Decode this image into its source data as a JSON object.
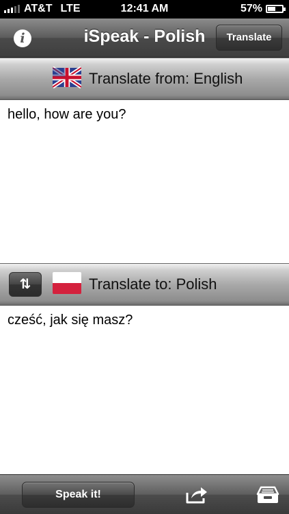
{
  "status_bar": {
    "carrier": "AT&T",
    "network": "LTE",
    "time": "12:41 AM",
    "battery_percent": "57%",
    "battery_level": 0.57
  },
  "nav": {
    "title": "iSpeak - Polish",
    "info_icon": "info-icon",
    "translate_label": "Translate"
  },
  "from": {
    "label": "Translate from: English",
    "flag": "uk-flag-icon",
    "text": "hello, how are you?"
  },
  "to": {
    "label": "Translate to: Polish",
    "flag": "poland-flag-icon",
    "text": "cześć, jak się masz?"
  },
  "toolbar": {
    "speak_label": "Speak it!",
    "share_icon": "share-icon",
    "archive_icon": "archive-icon"
  },
  "colors": {
    "poland_red": "#d4213d",
    "uk_blue": "#2b3f8f",
    "uk_red": "#c8102e"
  }
}
